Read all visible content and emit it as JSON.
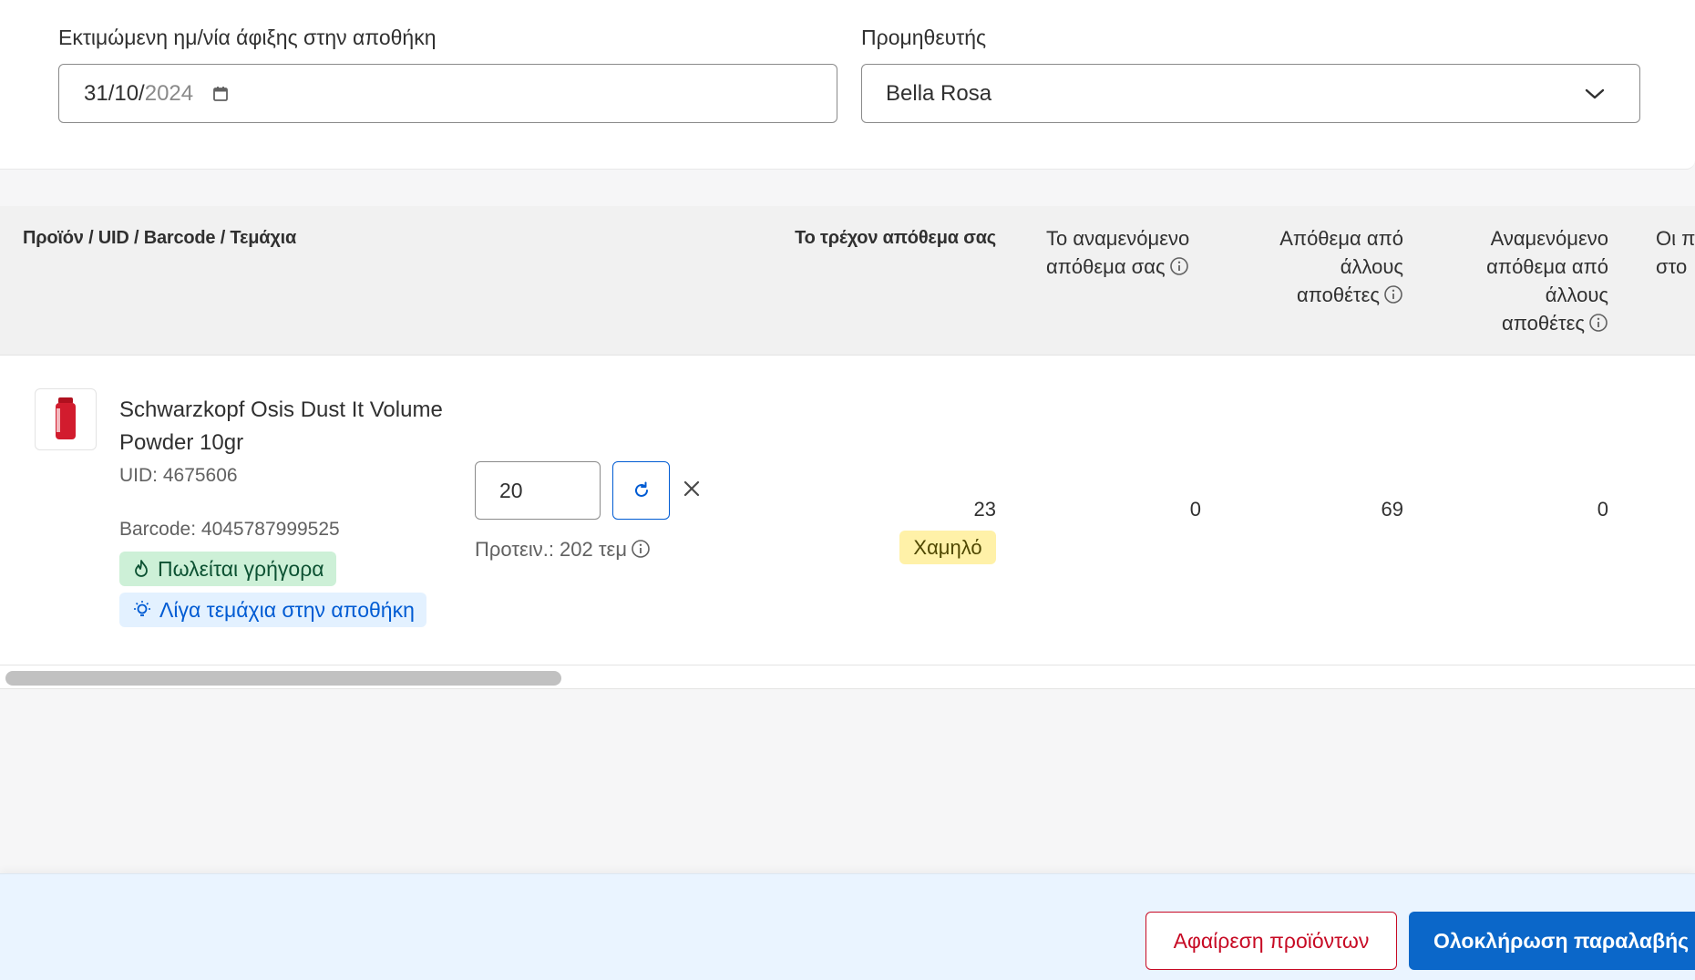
{
  "form": {
    "arrival_label": "Εκτιμώμενη ημ/νία άφιξης στην αποθήκη",
    "arrival_day_month": "31/10/",
    "arrival_year": "2024",
    "supplier_label": "Προμηθευτής",
    "supplier_value": "Bella Rosa"
  },
  "table": {
    "headers": {
      "product": "Προϊόν / UID / Barcode / Τεμάχια",
      "current_stock": "Το τρέχον απόθεμα σας",
      "expected_stock_l1": "Το αναμενόμενο",
      "expected_stock_l2": "απόθεμα σας",
      "other_stock_l1": "Απόθεμα από",
      "other_stock_l2": "άλλους",
      "other_stock_l3": "αποθέτες",
      "other_expected_l1": "Αναμενόμενο",
      "other_expected_l2": "απόθεμα από",
      "other_expected_l3": "άλλους",
      "other_expected_l4": "αποθέτες",
      "cut_l1": "Οι π",
      "cut_l2": "στο"
    },
    "row": {
      "name": "Schwarzkopf Osis Dust It Volume Powder 10gr",
      "uid": "UID: 4675606",
      "barcode": "Barcode: 4045787999525",
      "tag_fast": "Πωλείται γρήγορα",
      "tag_few": "Λίγα τεμάχια στην αποθήκη",
      "quantity": "20",
      "suggested": "Προτειν.: 202 τεμ",
      "current_stock": "23",
      "stock_level": "Χαμηλό",
      "expected_stock": "0",
      "other_stock": "69",
      "other_expected": "0"
    },
    "scroll_fraction": 0.33
  },
  "footer": {
    "remove_label": "Αφαίρεση προϊόντων",
    "complete_label": "Ολοκλήρωση παραλαβής"
  },
  "colors": {
    "primary": "#0b67c9",
    "critical": "#c70a24",
    "success_bg": "#cdf0d7",
    "info_bg": "#e3f1ff",
    "warning_bg": "#fff1a8"
  }
}
